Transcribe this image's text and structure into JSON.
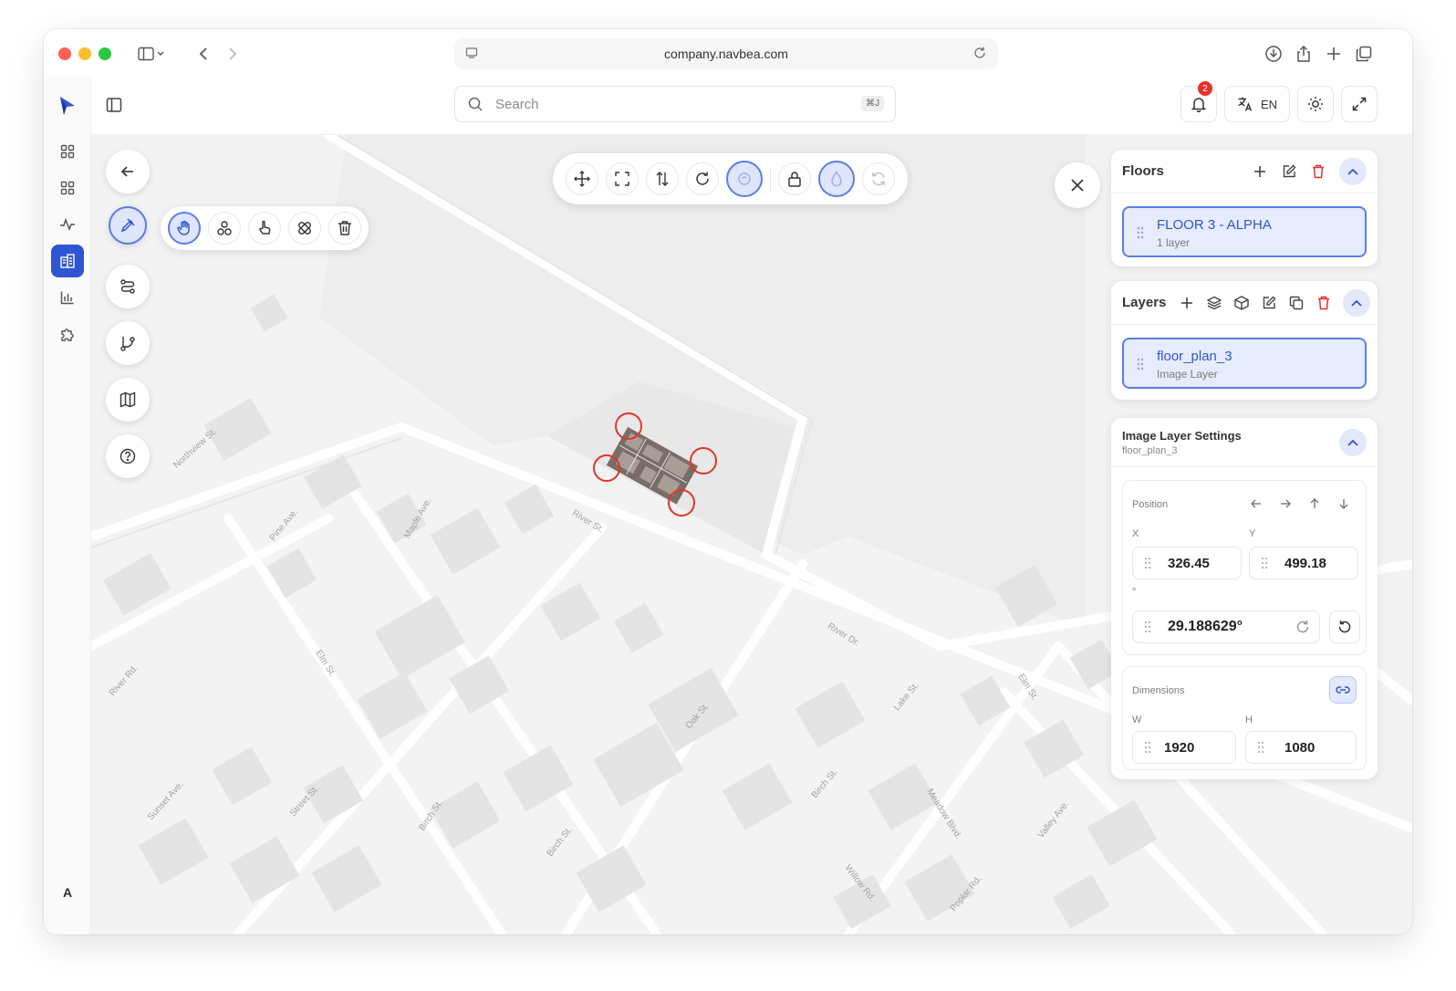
{
  "browser": {
    "url": "company.navbea.com"
  },
  "topbar": {
    "search_placeholder": "Search",
    "search_shortcut": "⌘J",
    "notification_count": "2",
    "language": "EN"
  },
  "rail": {
    "user_initial": "A"
  },
  "map": {
    "streets": [
      "Northview St.",
      "Pine Ave.",
      "Maple Ave.",
      "River St.",
      "River Dr.",
      "Elm St.",
      "River Rd.",
      "Sunset Ave.",
      "Street St.",
      "Birch St.",
      "Oak St.",
      "Lake St.",
      "Elm St.",
      "Birch St.",
      "Meadow Blvd.",
      "Valley Ave.",
      "Willow Rd.",
      "Poplar Rd.",
      "Birch St."
    ]
  },
  "floors": {
    "title": "Floors",
    "items": [
      {
        "name": "FLOOR 3 - ALPHA",
        "meta": "1 layer"
      }
    ]
  },
  "layers": {
    "title": "Layers",
    "items": [
      {
        "name": "floor_plan_3",
        "meta": "Image Layer"
      }
    ]
  },
  "image_settings": {
    "title": "Image Layer Settings",
    "subtitle": "floor_plan_3",
    "position_label": "Position",
    "x_label": "X",
    "y_label": "Y",
    "x_value": "326.45",
    "y_value": "499.18",
    "rotation_label": "°",
    "rotation_value": "29.188629°",
    "dimensions_label": "Dimensions",
    "w_label": "W",
    "h_label": "H",
    "w_value": "1920",
    "h_value": "1080"
  },
  "colors": {
    "accent": "#2f55d4",
    "accent_light": "#e6ecfc",
    "danger": "#e5322d",
    "map_background": "#f3f3f3"
  }
}
